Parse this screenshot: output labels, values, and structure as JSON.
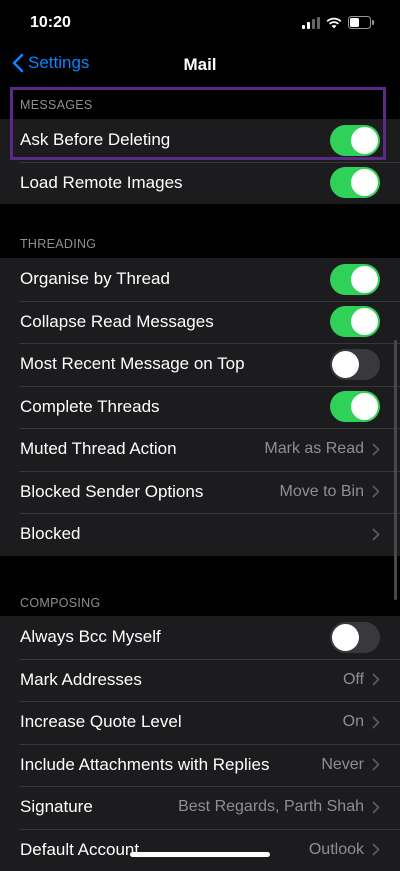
{
  "status_bar": {
    "time": "10:20"
  },
  "nav": {
    "back_label": "Settings",
    "title": "Mail"
  },
  "sections": {
    "messages": {
      "header": "MESSAGES",
      "rows": [
        {
          "label": "Ask Before Deleting",
          "toggle": true
        },
        {
          "label": "Load Remote Images",
          "toggle": true
        }
      ]
    },
    "threading": {
      "header": "THREADING",
      "rows": [
        {
          "label": "Organise by Thread",
          "toggle": true
        },
        {
          "label": "Collapse Read Messages",
          "toggle": true
        },
        {
          "label": "Most Recent Message on Top",
          "toggle": false
        },
        {
          "label": "Complete Threads",
          "toggle": true
        },
        {
          "label": "Muted Thread Action",
          "value": "Mark as Read"
        },
        {
          "label": "Blocked Sender Options",
          "value": "Move to Bin"
        },
        {
          "label": "Blocked",
          "value": ""
        }
      ]
    },
    "composing": {
      "header": "COMPOSING",
      "rows": [
        {
          "label": "Always Bcc Myself",
          "toggle": false
        },
        {
          "label": "Mark Addresses",
          "value": "Off"
        },
        {
          "label": "Increase Quote Level",
          "value": "On"
        },
        {
          "label": "Include Attachments with Replies",
          "value": "Never"
        },
        {
          "label": "Signature",
          "value": "Best Regards, Parth Shah"
        },
        {
          "label": "Default Account",
          "value": "Outlook"
        }
      ]
    }
  },
  "colors": {
    "accent": "#0a84ff",
    "toggle_on": "#30d158",
    "highlight": "#5b2a86"
  }
}
